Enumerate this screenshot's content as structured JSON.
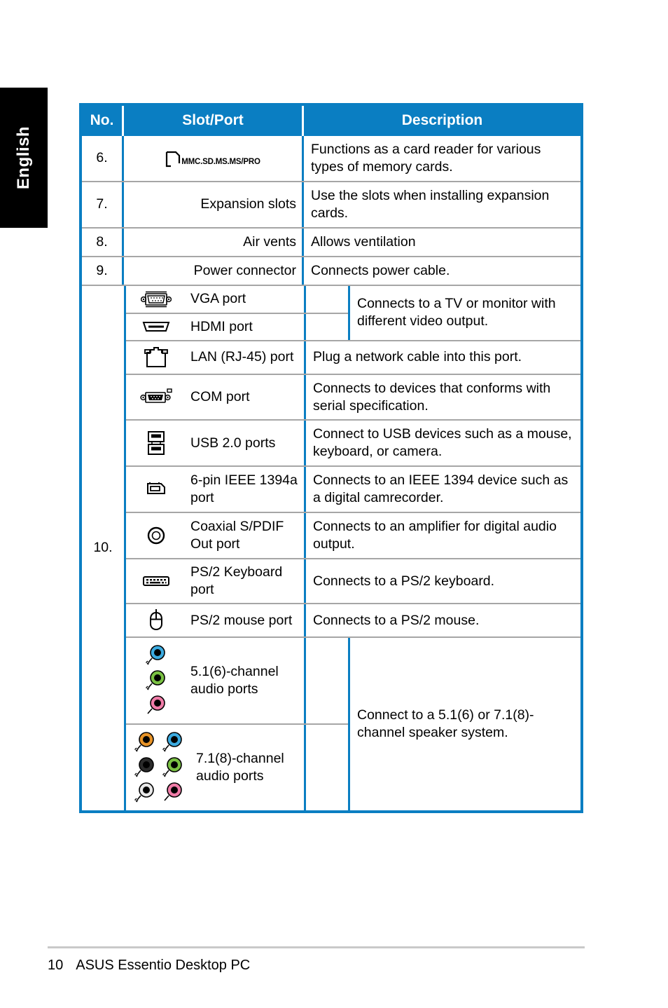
{
  "page": {
    "language_tab": "English",
    "footer_page_number": "10",
    "footer_title": "ASUS Essentio Desktop PC",
    "accent_color": "#0a7ec2",
    "rule_color": "#a6a6a6",
    "tab_background": "#000000"
  },
  "table": {
    "headers": {
      "no": "No.",
      "slot_port": "Slot/Port",
      "description": "Description"
    },
    "rows": [
      {
        "no": "6.",
        "icon": "card-reader-icon",
        "icon_label": "MMC.SD.MS.MS/PRO",
        "slot_port": "",
        "description": "Functions as a card reader for various types of memory cards."
      },
      {
        "no": "7.",
        "icon": "",
        "slot_port": "Expansion slots",
        "description": "Use the slots when installing expansion cards."
      },
      {
        "no": "8.",
        "icon": "",
        "slot_port": "Air vents",
        "description": "Allows ventilation"
      },
      {
        "no": "9.",
        "icon": "",
        "slot_port": "Power connector",
        "description": "Connects power cable."
      }
    ],
    "group10": {
      "no": "10.",
      "subrows": [
        {
          "icon": "vga-port-icon",
          "slot_port": "VGA port"
        },
        {
          "icon": "hdmi-port-icon",
          "slot_port": "HDMI port"
        }
      ],
      "video_description": "Connects to a TV or monitor with different video output.",
      "lan": {
        "icon": "lan-rj45-icon",
        "slot_port": "LAN (RJ-45) port",
        "description": "Plug a network cable into this port."
      },
      "com": {
        "icon": "com-port-icon",
        "slot_port": "COM port",
        "description": "Connects to devices that conforms with serial specification."
      },
      "usb": {
        "icon": "usb-port-icon",
        "slot_port": "USB 2.0 ports",
        "description": "Connect to USB devices such as a mouse, keyboard, or camera."
      },
      "ieee1394": {
        "icon": "ieee1394-port-icon",
        "slot_port": "6-pin IEEE 1394a port",
        "description": "Connects to an IEEE 1394 device such as a digital camrecorder."
      },
      "spdif": {
        "icon": "coaxial-spdif-icon",
        "slot_port": "Coaxial S/PDIF Out port",
        "description": "Connects to an amplifier for digital audio output."
      },
      "ps2_keyboard": {
        "icon": "ps2-keyboard-icon",
        "slot_port": "PS/2 Keyboard port",
        "description": "Connects to a PS/2 keyboard."
      },
      "ps2_mouse": {
        "icon": "ps2-mouse-icon",
        "slot_port": "PS/2 mouse port",
        "description": "Connects to a PS/2 mouse."
      },
      "audio_51": {
        "icon": "audio-jacks-51-icon",
        "slot_port": "5.1(6)-channel audio ports",
        "jack_colors": [
          "#3cabe0",
          "#7ac143",
          "#f07ca8"
        ]
      },
      "audio_71": {
        "icon": "audio-jacks-71-icon",
        "slot_port": "7.1(8)-channel audio ports",
        "jack_colors": [
          "#e79327",
          "#3cabe0",
          "#2b2b2b",
          "#7ac143",
          "#e8e8e8",
          "#f07ca8"
        ]
      },
      "audio_description": "Connect to a 5.1(6) or 7.1(8)-channel speaker system."
    }
  }
}
